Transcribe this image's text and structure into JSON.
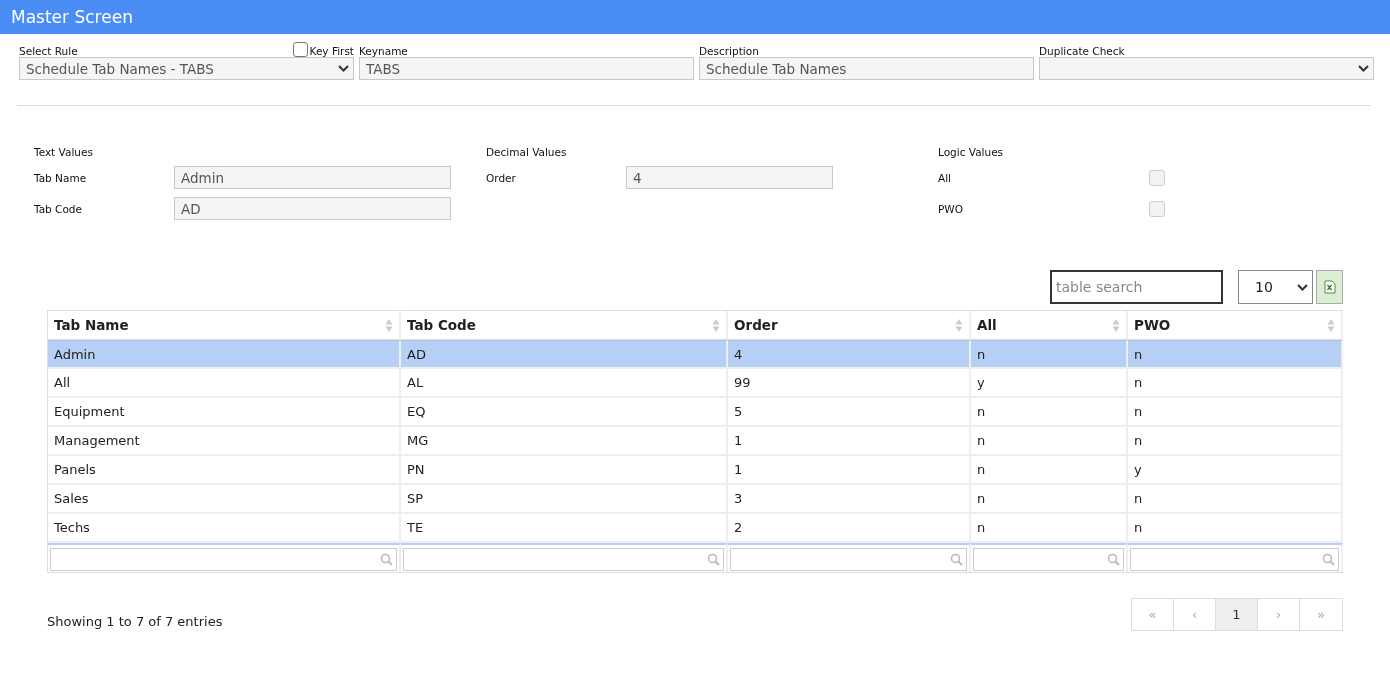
{
  "header": {
    "title": "Master Screen"
  },
  "rule_form": {
    "select_rule": {
      "label": "Select Rule",
      "value": "Schedule Tab Names - TABS"
    },
    "key_first": {
      "label": "Key First",
      "checked": false
    },
    "keyname": {
      "label": "Keyname",
      "value": "TABS"
    },
    "description": {
      "label": "Description",
      "value": "Schedule Tab Names"
    },
    "duplicate_check": {
      "label": "Duplicate Check"
    }
  },
  "values": {
    "text_values": {
      "title": "Text Values",
      "fields": [
        {
          "label": "Tab Name",
          "value": "Admin"
        },
        {
          "label": "Tab Code",
          "value": "AD"
        }
      ]
    },
    "decimal_values": {
      "title": "Decimal Values",
      "fields": [
        {
          "label": "Order",
          "value": "4"
        }
      ]
    },
    "logic_values": {
      "title": "Logic Values",
      "fields": [
        {
          "label": "All",
          "checked": false
        },
        {
          "label": "PWO",
          "checked": false
        }
      ]
    }
  },
  "table_tools": {
    "search_placeholder": "table search",
    "page_size": "10"
  },
  "table": {
    "columns": [
      "Tab Name",
      "Tab Code",
      "Order",
      "All",
      "PWO"
    ],
    "rows": [
      {
        "cells": [
          "Admin",
          "AD",
          "4",
          "n",
          "n"
        ],
        "selected": true
      },
      {
        "cells": [
          "All",
          "AL",
          "99",
          "y",
          "n"
        ],
        "selected": false
      },
      {
        "cells": [
          "Equipment",
          "EQ",
          "5",
          "n",
          "n"
        ],
        "selected": false
      },
      {
        "cells": [
          "Management",
          "MG",
          "1",
          "n",
          "n"
        ],
        "selected": false
      },
      {
        "cells": [
          "Panels",
          "PN",
          "1",
          "n",
          "y"
        ],
        "selected": false
      },
      {
        "cells": [
          "Sales",
          "SP",
          "3",
          "n",
          "n"
        ],
        "selected": false
      },
      {
        "cells": [
          "Techs",
          "TE",
          "2",
          "n",
          "n"
        ],
        "selected": false
      }
    ]
  },
  "footer": {
    "info": "Showing 1 to 7 of 7 entries",
    "pagination": [
      {
        "label": "«",
        "selected": false
      },
      {
        "label": "‹",
        "selected": false
      },
      {
        "label": "1",
        "selected": true
      },
      {
        "label": "›",
        "selected": false
      },
      {
        "label": "»",
        "selected": false
      }
    ]
  }
}
